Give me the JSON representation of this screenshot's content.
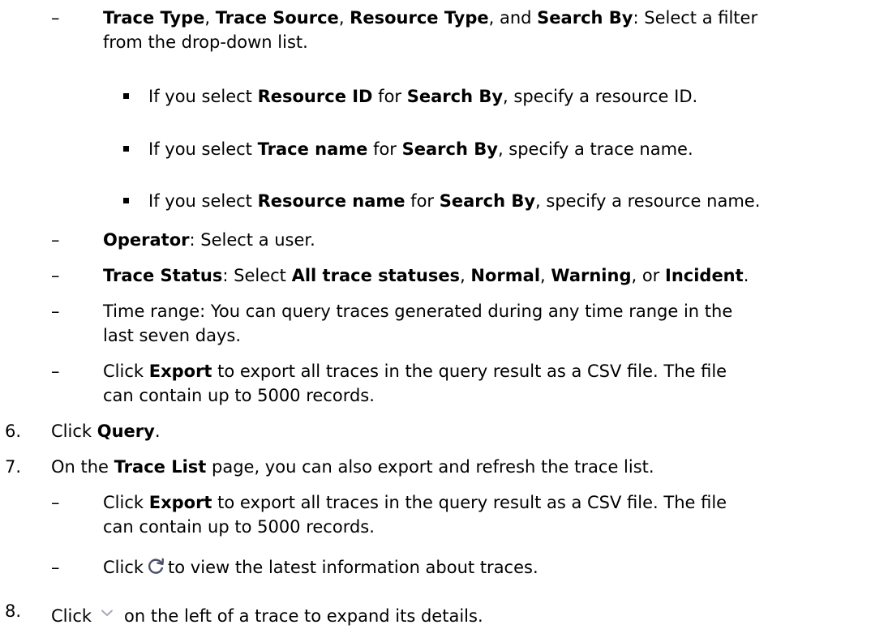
{
  "doc": {
    "filters_line": {
      "b1": "Trace Type",
      "s1": ", ",
      "b2": "Trace Source",
      "s2": ", ",
      "b3": "Resource Type",
      "s3": ", and ",
      "b4": "Search By",
      "s4": ": Select a filter",
      "cont": "from the drop-down list."
    },
    "sub_items": [
      {
        "pre": "If you select ",
        "b1": "Resource ID",
        "mid": " for ",
        "b2": "Search By",
        "post": ", specify a resource ID."
      },
      {
        "pre": "If you select ",
        "b1": "Trace name",
        "mid": " for ",
        "b2": "Search By",
        "post": ", specify a trace name."
      },
      {
        "pre": "If you select ",
        "b1": "Resource name",
        "mid": " for ",
        "b2": "Search By",
        "post": ", specify a resource name."
      }
    ],
    "operator": {
      "b": "Operator",
      "text": ": Select a user."
    },
    "trace_status": {
      "b0": "Trace Status",
      "t0": ": Select ",
      "b1": "All trace statuses",
      "t1": ", ",
      "b2": "Normal",
      "t2": ", ",
      "b3": "Warning",
      "t3": ", or ",
      "b4": "Incident",
      "t4": "."
    },
    "time_range": {
      "line1": "Time range: You can query traces generated during any time range in the",
      "line2": "last seven days."
    },
    "export1": {
      "pre": "Click ",
      "b": "Export",
      "post": " to export all traces in the query result as a CSV file. The file",
      "line2": "can contain up to 5000 records."
    },
    "step6": {
      "num": "6.",
      "pre": "Click ",
      "b": "Query",
      "post": "."
    },
    "step7": {
      "num": "7.",
      "pre": "On the ",
      "b": "Trace List",
      "post": " page, you can also export and refresh the trace list."
    },
    "export2": {
      "pre": "Click ",
      "b": "Export",
      "post": " to export all traces in the query result as a CSV file. The file",
      "line2": "can contain up to 5000 records."
    },
    "refresh": {
      "pre": "Click",
      "post": "to view the latest information about traces."
    },
    "step8": {
      "num": "8.",
      "pre": "Click",
      "post": "on the left of a trace to expand its details."
    },
    "dash": "–"
  }
}
